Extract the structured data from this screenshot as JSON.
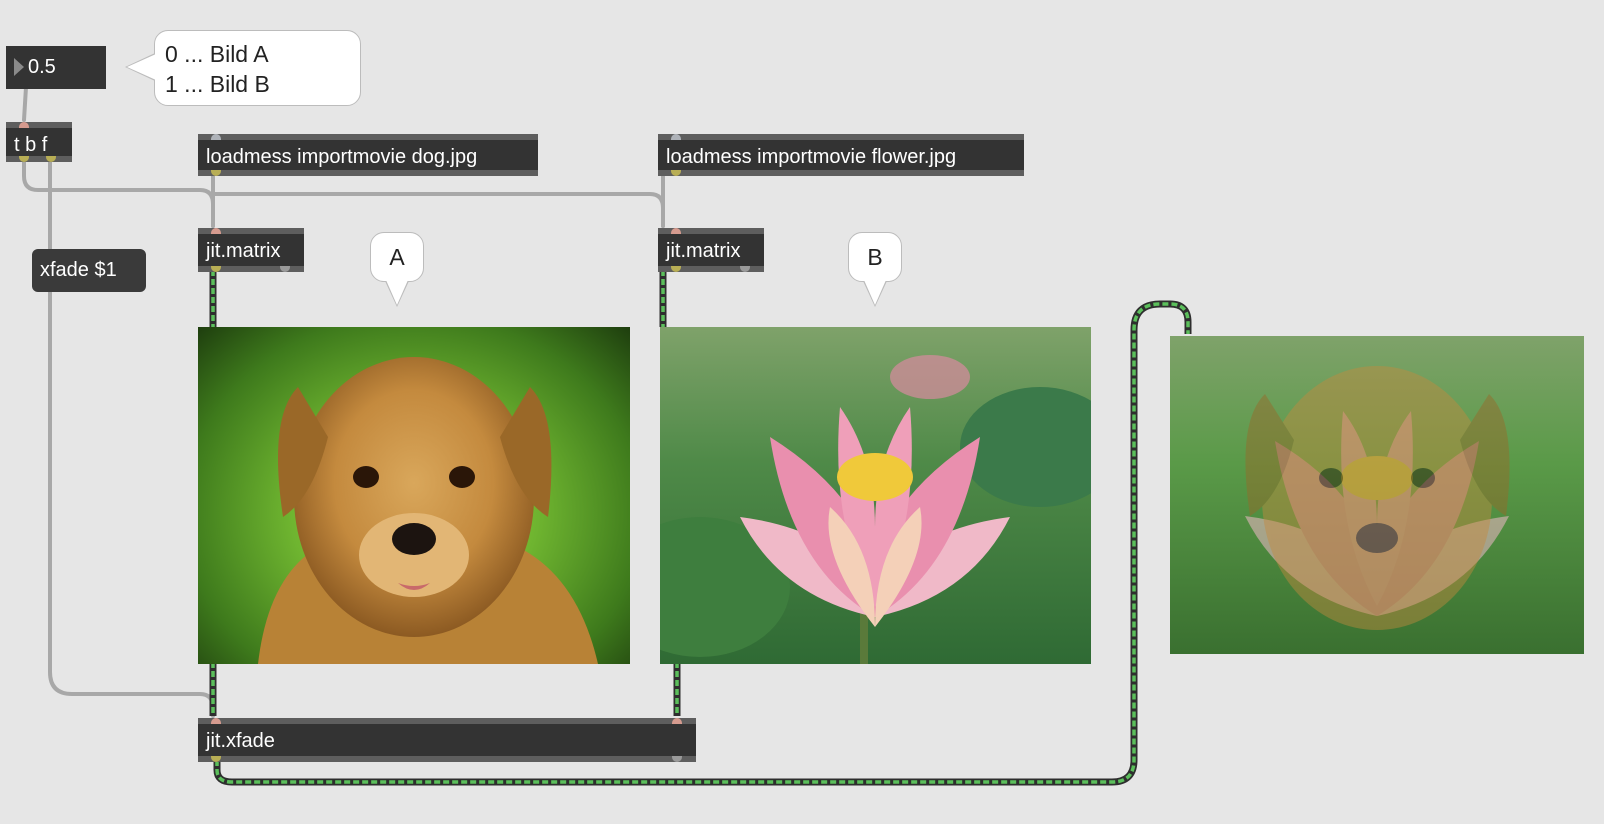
{
  "numbox": {
    "value": "0.5"
  },
  "comment_fade": {
    "line1": "0 ... Bild A",
    "line2": "1 ... Bild B"
  },
  "trigger": {
    "label": "t b f"
  },
  "loadmess_a": {
    "label": "loadmess importmovie dog.jpg"
  },
  "loadmess_b": {
    "label": "loadmess importmovie flower.jpg"
  },
  "matrix_a": {
    "label": "jit.matrix"
  },
  "matrix_b": {
    "label": "jit.matrix"
  },
  "msg_xfade": {
    "label": "xfade $1"
  },
  "bubble_a": {
    "label": "A"
  },
  "bubble_b": {
    "label": "B"
  },
  "xfade": {
    "label": "jit.xfade"
  },
  "colors": {
    "background": "#e6e6e6",
    "object": "#333333",
    "jitter_cord": "#5bbf5b",
    "patch_cord": "#a8a8a8"
  }
}
